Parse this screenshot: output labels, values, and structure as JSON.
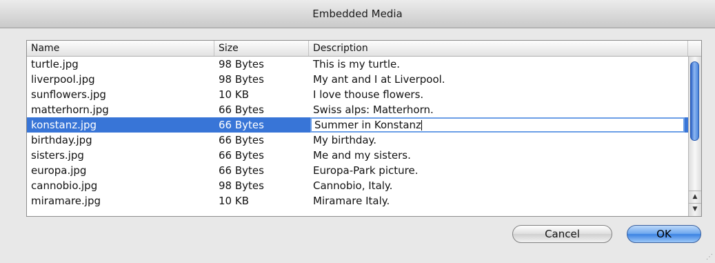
{
  "window": {
    "title": "Embedded Media"
  },
  "table": {
    "columns": {
      "name": "Name",
      "size": "Size",
      "description": "Description"
    },
    "rows": [
      {
        "name": "turtle.jpg",
        "size": "98 Bytes",
        "description": "This is my turtle."
      },
      {
        "name": "liverpool.jpg",
        "size": "98 Bytes",
        "description": "My ant and I at Liverpool."
      },
      {
        "name": "sunflowers.jpg",
        "size": "10 KB",
        "description": "I love thouse flowers."
      },
      {
        "name": "matterhorn.jpg",
        "size": "66 Bytes",
        "description": "Swiss alps: Matterhorn."
      },
      {
        "name": "konstanz.jpg",
        "size": "66 Bytes",
        "description": "Summer in Konstanz",
        "selected": true,
        "editing": true
      },
      {
        "name": "birthday.jpg",
        "size": "66 Bytes",
        "description": "My birthday."
      },
      {
        "name": "sisters.jpg",
        "size": "66 Bytes",
        "description": "Me and my sisters."
      },
      {
        "name": "europa.jpg",
        "size": "66 Bytes",
        "description": "Europa-Park picture."
      },
      {
        "name": "cannobio.jpg",
        "size": "98 Bytes",
        "description": "Cannobio, Italy."
      },
      {
        "name": "miramare.jpg",
        "size": "10 KB",
        "description": "Miramare Italy."
      }
    ],
    "scroll": {
      "up_arrow": "▲",
      "down_arrow": "▼"
    }
  },
  "buttons": {
    "cancel": "Cancel",
    "ok": "OK"
  },
  "colors": {
    "selection": "#3875d7",
    "default_button": "#3b82e2"
  }
}
